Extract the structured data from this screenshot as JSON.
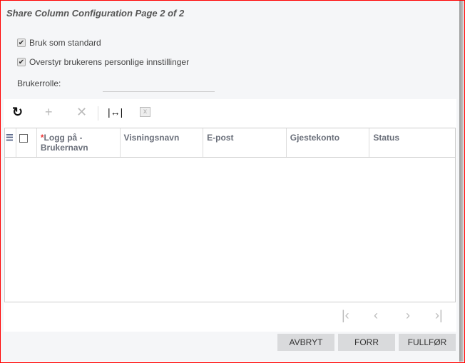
{
  "title": "Share Column Configuration Page 2 of 2",
  "options": [
    {
      "label": "Bruk som standard",
      "checked": true
    },
    {
      "label": "Overstyr brukerens personlige innstillinger",
      "checked": true
    }
  ],
  "role_label": "Brukerrolle:",
  "role_value": "",
  "columns": [
    "Logg på - Brukernavn",
    "Visningsnavn",
    "E-post",
    "Gjestekonto",
    "Status"
  ],
  "required_mark": "*",
  "buttons": {
    "cancel": "AVBRYT",
    "prev": "FORR",
    "finish": "FULLFØR"
  }
}
